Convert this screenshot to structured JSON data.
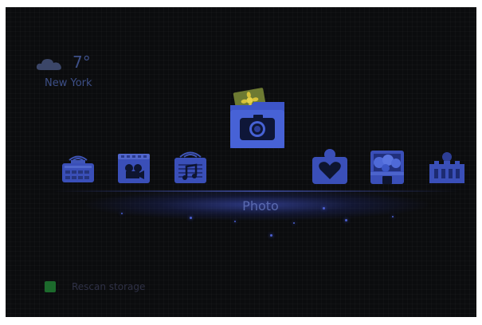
{
  "weather": {
    "icon": "cloud-icon",
    "temperature": "7°",
    "city": "New York"
  },
  "menu": {
    "items": [
      {
        "name": "radio-icon"
      },
      {
        "name": "movie-icon"
      },
      {
        "name": "music-icon"
      },
      {
        "name": "photo-icon",
        "selected": true
      },
      {
        "name": "favorites-icon"
      },
      {
        "name": "games-icon"
      },
      {
        "name": "settings-icon"
      }
    ],
    "selected_label": "Photo"
  },
  "footer": {
    "key_color": "#1c6a2c",
    "rescan_label": "Rescan storage"
  },
  "colors": {
    "background": "#0b0c0e",
    "icon_blue": "#3a53c6",
    "highlight": "#4a5fd8"
  }
}
